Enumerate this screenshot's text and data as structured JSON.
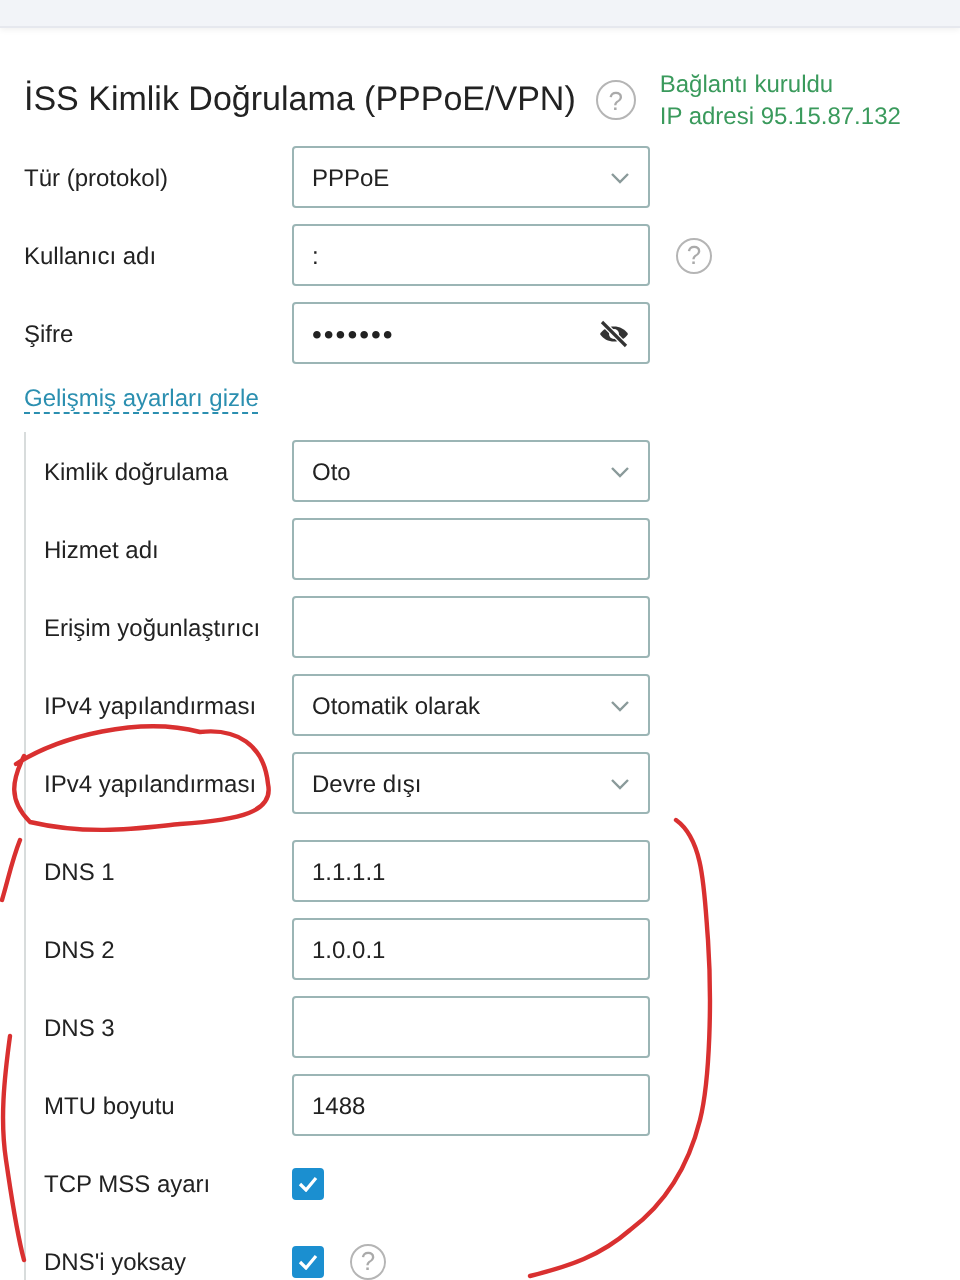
{
  "section": {
    "title": "İSS Kimlik Doğrulama (PPPoE/VPN)",
    "help": "?",
    "status": [
      "Bağlantı kuruldu",
      "IP adresi 95.15.87.132"
    ]
  },
  "fields": [
    {
      "kind": "select",
      "label": "Tür (protokol)",
      "value": "PPPoE"
    },
    {
      "kind": "text",
      "label": "Kullanıcı adı",
      "value": ":",
      "help": "?"
    },
    {
      "kind": "password",
      "label": "Şifre",
      "value": "•••••••"
    }
  ],
  "advanced_toggle": "Gelişmiş ayarları gizle",
  "advanced": [
    {
      "kind": "select",
      "label": "Kimlik doğrulama",
      "value": "Oto"
    },
    {
      "kind": "text",
      "label": "Hizmet adı"
    },
    {
      "kind": "text",
      "label": "Erişim yoğunlaştırıcı"
    },
    {
      "kind": "select",
      "label": "IPv4 yapılandırması",
      "value": "Otomatik olarak"
    },
    {
      "kind": "select",
      "label": "IPv4 yapılandırması",
      "value": "Devre dışı"
    },
    {
      "kind": "text",
      "label": "DNS 1",
      "value": "1.1.1.1"
    },
    {
      "kind": "text",
      "label": "DNS 2",
      "value": "1.0.0.1"
    },
    {
      "kind": "text",
      "label": "DNS 3"
    },
    {
      "kind": "text",
      "label": "MTU boyutu",
      "value": "1488"
    },
    {
      "kind": "checkbox",
      "label": "TCP MSS ayarı",
      "checked": true
    },
    {
      "kind": "checkbox",
      "label": "DNS'i yoksay",
      "checked": true,
      "help": "?"
    }
  ]
}
